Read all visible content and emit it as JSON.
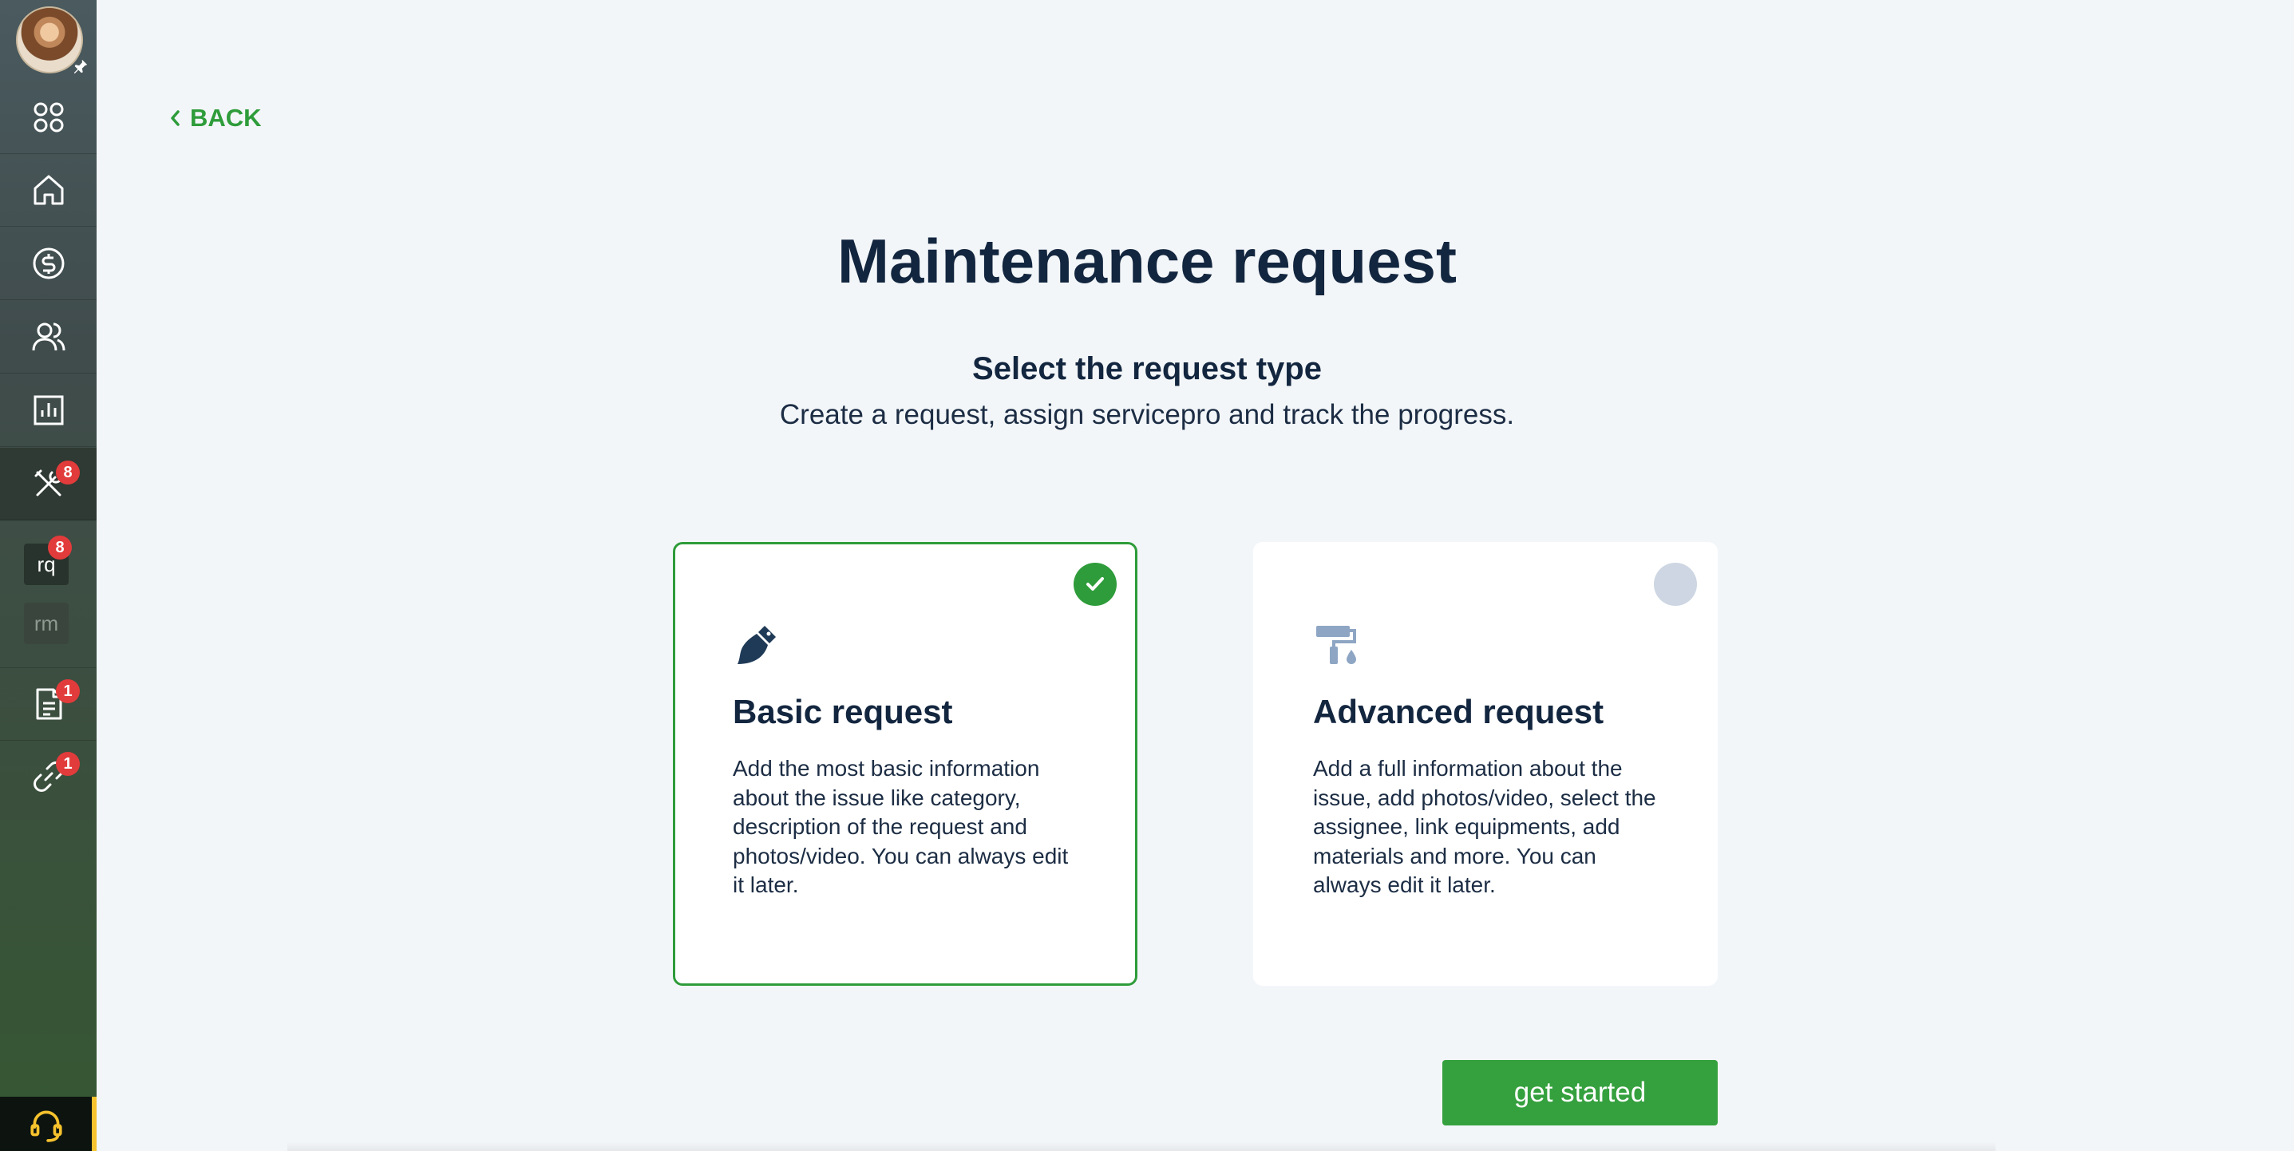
{
  "sidebar": {
    "items": [
      {
        "icon": "grid-icon"
      },
      {
        "icon": "home-icon"
      },
      {
        "icon": "dollar-icon"
      },
      {
        "icon": "users-icon"
      },
      {
        "icon": "bar-chart-icon"
      },
      {
        "icon": "tools-icon",
        "badge": "8",
        "active": true
      },
      {
        "icon": "document-icon",
        "badge": "1"
      },
      {
        "icon": "link-icon",
        "badge": "1"
      }
    ],
    "rq_label": "rq",
    "rq_badge": "8",
    "rm_label": "rm"
  },
  "back_label": "BACK",
  "page_title": "Maintenance request",
  "subtitle": "Select the request type",
  "subtext": "Create a request, assign servicepro and track the progress.",
  "cards": [
    {
      "title": "Basic request",
      "description": "Add the most basic information about the issue like category, description of the request and photos/video. You can always edit it later.",
      "selected": true
    },
    {
      "title": "Advanced request",
      "description": "Add a full information about the issue, add photos/video, select the assignee, link equipments, add materials and more. You can always edit it later.",
      "selected": false
    }
  ],
  "cta_label": "get started",
  "colors": {
    "accent": "#2e9c3a",
    "title": "#13263f",
    "badge": "#e23b3b",
    "background": "#f3f6f9"
  }
}
